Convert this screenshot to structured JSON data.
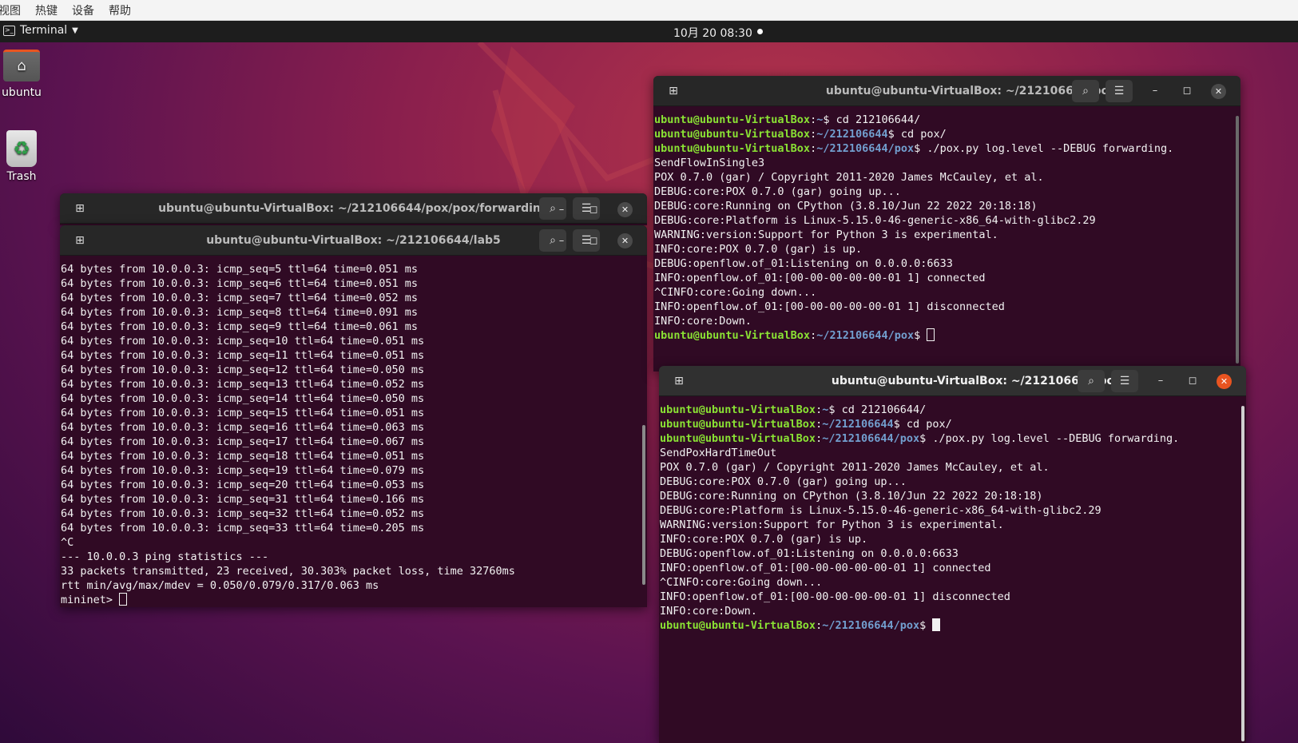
{
  "host_menu": [
    "视图",
    "热键",
    "设备",
    "帮助"
  ],
  "topbar": {
    "app_label": "Terminal",
    "clock": "10月 20 08:30"
  },
  "desktop_icons": [
    {
      "label": "ubuntu"
    },
    {
      "label": "Trash"
    }
  ],
  "windows": {
    "back_left": {
      "title": "ubuntu@ubuntu-VirtualBox: ~/212106644/pox/pox/forwarding"
    },
    "lab5": {
      "title": "ubuntu@ubuntu-VirtualBox: ~/212106644/lab5",
      "lines": [
        "64 bytes from 10.0.0.3: icmp_seq=5 ttl=64 time=0.051 ms",
        "64 bytes from 10.0.0.3: icmp_seq=6 ttl=64 time=0.051 ms",
        "64 bytes from 10.0.0.3: icmp_seq=7 ttl=64 time=0.052 ms",
        "64 bytes from 10.0.0.3: icmp_seq=8 ttl=64 time=0.091 ms",
        "64 bytes from 10.0.0.3: icmp_seq=9 ttl=64 time=0.061 ms",
        "64 bytes from 10.0.0.3: icmp_seq=10 ttl=64 time=0.051 ms",
        "64 bytes from 10.0.0.3: icmp_seq=11 ttl=64 time=0.051 ms",
        "64 bytes from 10.0.0.3: icmp_seq=12 ttl=64 time=0.050 ms",
        "64 bytes from 10.0.0.3: icmp_seq=13 ttl=64 time=0.052 ms",
        "64 bytes from 10.0.0.3: icmp_seq=14 ttl=64 time=0.050 ms",
        "64 bytes from 10.0.0.3: icmp_seq=15 ttl=64 time=0.051 ms",
        "64 bytes from 10.0.0.3: icmp_seq=16 ttl=64 time=0.063 ms",
        "64 bytes from 10.0.0.3: icmp_seq=17 ttl=64 time=0.067 ms",
        "64 bytes from 10.0.0.3: icmp_seq=18 ttl=64 time=0.051 ms",
        "64 bytes from 10.0.0.3: icmp_seq=19 ttl=64 time=0.079 ms",
        "64 bytes from 10.0.0.3: icmp_seq=20 ttl=64 time=0.053 ms",
        "64 bytes from 10.0.0.3: icmp_seq=31 ttl=64 time=0.166 ms",
        "64 bytes from 10.0.0.3: icmp_seq=32 ttl=64 time=0.052 ms",
        "64 bytes from 10.0.0.3: icmp_seq=33 ttl=64 time=0.205 ms",
        "^C",
        "--- 10.0.0.3 ping statistics ---",
        "33 packets transmitted, 23 received, 30.303% packet loss, time 32760ms",
        "rtt min/avg/max/mdev = 0.050/0.079/0.317/0.063 ms"
      ],
      "prompt": "mininet> "
    },
    "pox_top": {
      "title": "ubuntu@ubuntu-VirtualBox: ~/212106644/pox",
      "lines": [
        {
          "user": "ubuntu@ubuntu-VirtualBox",
          "path": "~",
          "cmd": "$ cd 212106644/"
        },
        {
          "user": "ubuntu@ubuntu-VirtualBox",
          "path": "~/212106644",
          "cmd": "$ cd pox/"
        },
        {
          "user": "ubuntu@ubuntu-VirtualBox",
          "path": "~/212106644/pox",
          "cmd": "$ ./pox.py log.level --DEBUG forwarding."
        },
        {
          "text": "SendFlowInSingle3"
        },
        {
          "text": "POX 0.7.0 (gar) / Copyright 2011-2020 James McCauley, et al."
        },
        {
          "text": "DEBUG:core:POX 0.7.0 (gar) going up..."
        },
        {
          "text": "DEBUG:core:Running on CPython (3.8.10/Jun 22 2022 20:18:18)"
        },
        {
          "text": "DEBUG:core:Platform is Linux-5.15.0-46-generic-x86_64-with-glibc2.29"
        },
        {
          "text": "WARNING:version:Support for Python 3 is experimental."
        },
        {
          "text": "INFO:core:POX 0.7.0 (gar) is up."
        },
        {
          "text": "DEBUG:openflow.of_01:Listening on 0.0.0.0:6633"
        },
        {
          "text": "INFO:openflow.of_01:[00-00-00-00-00-01 1] connected"
        },
        {
          "text": "^CINFO:core:Going down..."
        },
        {
          "text": "INFO:openflow.of_01:[00-00-00-00-00-01 1] disconnected"
        },
        {
          "text": "INFO:core:Down."
        }
      ],
      "prompt": {
        "user": "ubuntu@ubuntu-VirtualBox",
        "path": "~/212106644/pox",
        "cmd": "$ "
      }
    },
    "pox_bottom": {
      "title": "ubuntu@ubuntu-VirtualBox: ~/212106644/pox",
      "lines": [
        {
          "user": "ubuntu@ubuntu-VirtualBox",
          "path": "~",
          "cmd": "$ cd 212106644/"
        },
        {
          "user": "ubuntu@ubuntu-VirtualBox",
          "path": "~/212106644",
          "cmd": "$ cd pox/"
        },
        {
          "user": "ubuntu@ubuntu-VirtualBox",
          "path": "~/212106644/pox",
          "cmd": "$ ./pox.py log.level --DEBUG forwarding."
        },
        {
          "text": "SendPoxHardTimeOut"
        },
        {
          "text": "POX 0.7.0 (gar) / Copyright 2011-2020 James McCauley, et al."
        },
        {
          "text": "DEBUG:core:POX 0.7.0 (gar) going up..."
        },
        {
          "text": "DEBUG:core:Running on CPython (3.8.10/Jun 22 2022 20:18:18)"
        },
        {
          "text": "DEBUG:core:Platform is Linux-5.15.0-46-generic-x86_64-with-glibc2.29"
        },
        {
          "text": "WARNING:version:Support for Python 3 is experimental."
        },
        {
          "text": "INFO:core:POX 0.7.0 (gar) is up."
        },
        {
          "text": "DEBUG:openflow.of_01:Listening on 0.0.0.0:6633"
        },
        {
          "text": "INFO:openflow.of_01:[00-00-00-00-00-01 1] connected"
        },
        {
          "text": "^CINFO:core:Going down..."
        },
        {
          "text": "INFO:openflow.of_01:[00-00-00-00-00-01 1] disconnected"
        },
        {
          "text": "INFO:core:Down."
        }
      ],
      "prompt": {
        "user": "ubuntu@ubuntu-VirtualBox",
        "path": "~/212106644/pox",
        "cmd": "$ "
      }
    }
  },
  "colors": {
    "terminal_bg": "#300a24",
    "prompt_user": "#8ae234",
    "prompt_path": "#729fcf",
    "close_active": "#e95420"
  },
  "icons": [
    "terminal-icon",
    "new-tab-icon",
    "search-icon",
    "menu-icon",
    "minimize-icon",
    "maximize-icon",
    "close-icon",
    "home-folder-icon",
    "trash-icon"
  ]
}
